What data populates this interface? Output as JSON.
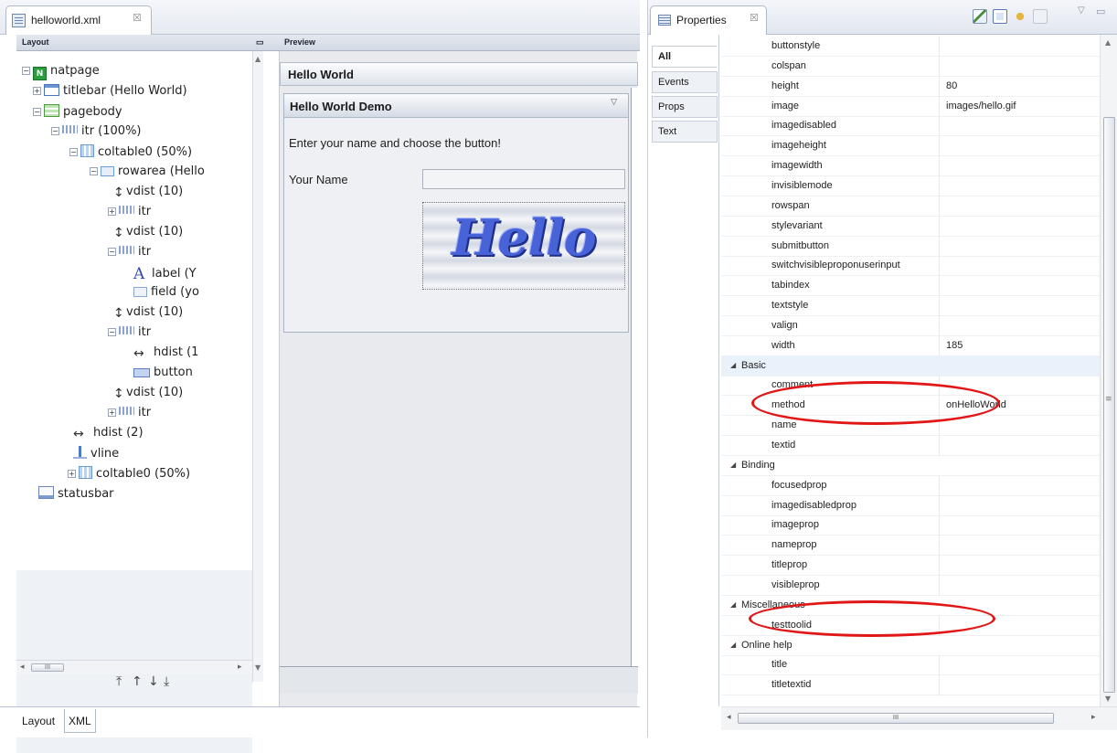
{
  "editor": {
    "tab_title": "helloworld.xml",
    "close_glyph": "☒",
    "layout_header": "Layout",
    "preview_header": "Preview",
    "tree": [
      {
        "label": "natpage",
        "icon": "natpage-icon",
        "toggle": "−"
      },
      {
        "label": "titlebar (Hello World)",
        "icon": "titlebar-icon",
        "toggle": "+"
      },
      {
        "label": "pagebody",
        "icon": "pagebody-icon",
        "toggle": "−"
      },
      {
        "label": "itr (100%)",
        "icon": "itr-icon",
        "toggle": "−"
      },
      {
        "label": "coltable0 (50%)",
        "icon": "coltable-icon",
        "toggle": "−"
      },
      {
        "label": "rowarea (Hello",
        "icon": "rowarea-icon",
        "toggle": "−"
      },
      {
        "label": "vdist (10)",
        "icon": "vdist-icon",
        "toggle": ""
      },
      {
        "label": "itr",
        "icon": "itr-icon",
        "toggle": "+"
      },
      {
        "label": "vdist (10)",
        "icon": "vdist-icon",
        "toggle": ""
      },
      {
        "label": "itr",
        "icon": "itr-icon",
        "toggle": "−"
      },
      {
        "label": "label (Y",
        "icon": "label-icon",
        "toggle": ""
      },
      {
        "label": "field (yo",
        "icon": "field-icon",
        "toggle": ""
      },
      {
        "label": "vdist (10)",
        "icon": "vdist-icon",
        "toggle": ""
      },
      {
        "label": "itr",
        "icon": "itr-icon",
        "toggle": "−"
      },
      {
        "label": "hdist (1",
        "icon": "hdist-icon",
        "toggle": ""
      },
      {
        "label": "button",
        "icon": "button-icon",
        "toggle": ""
      },
      {
        "label": "vdist (10)",
        "icon": "vdist-icon",
        "toggle": ""
      },
      {
        "label": "itr",
        "icon": "itr-icon",
        "toggle": "+"
      },
      {
        "label": "hdist (2)",
        "icon": "hdist-icon",
        "toggle": ""
      },
      {
        "label": "vline",
        "icon": "vline-icon",
        "toggle": ""
      },
      {
        "label": "coltable0 (50%)",
        "icon": "coltable-icon",
        "toggle": "+"
      },
      {
        "label": "statusbar",
        "icon": "statusbar-icon",
        "toggle": ""
      }
    ],
    "move_buttons": [
      "⤒",
      "↑",
      "↓",
      "⤓"
    ],
    "bottom_tabs": [
      "Layout",
      "XML"
    ],
    "preview": {
      "page_title": "Hello World",
      "box_title": "Hello World Demo",
      "instruction": "Enter your name and choose the button!",
      "name_label": "Your Name",
      "name_value": "",
      "button_image_text": "Hello"
    }
  },
  "properties": {
    "tab_title": "Properties",
    "close_glyph": "☒",
    "categories": [
      "All",
      "Events",
      "Props",
      "Text"
    ],
    "rows": [
      {
        "name": "buttonstyle",
        "value": ""
      },
      {
        "name": "colspan",
        "value": ""
      },
      {
        "name": "height",
        "value": "80"
      },
      {
        "name": "image",
        "value": "images/hello.gif"
      },
      {
        "name": "imagedisabled",
        "value": ""
      },
      {
        "name": "imageheight",
        "value": ""
      },
      {
        "name": "imagewidth",
        "value": ""
      },
      {
        "name": "invisiblemode",
        "value": ""
      },
      {
        "name": "rowspan",
        "value": ""
      },
      {
        "name": "stylevariant",
        "value": ""
      },
      {
        "name": "submitbutton",
        "value": ""
      },
      {
        "name": "switchvisibleproponuserinput",
        "value": ""
      },
      {
        "name": "tabindex",
        "value": ""
      },
      {
        "name": "textstyle",
        "value": ""
      },
      {
        "name": "valign",
        "value": ""
      },
      {
        "name": "width",
        "value": "185"
      },
      {
        "category": "Basic"
      },
      {
        "name": "comment",
        "value": ""
      },
      {
        "name": "method",
        "value": "onHelloWorld"
      },
      {
        "name": "name",
        "value": ""
      },
      {
        "name": "textid",
        "value": ""
      },
      {
        "category": "Binding"
      },
      {
        "name": "focusedprop",
        "value": ""
      },
      {
        "name": "imagedisabledprop",
        "value": ""
      },
      {
        "name": "imageprop",
        "value": ""
      },
      {
        "name": "nameprop",
        "value": ""
      },
      {
        "name": "titleprop",
        "value": ""
      },
      {
        "name": "visibleprop",
        "value": ""
      },
      {
        "category": "Miscellaneous"
      },
      {
        "name": "testtoolid",
        "value": ""
      },
      {
        "category": "Online help"
      },
      {
        "name": "title",
        "value": ""
      },
      {
        "name": "titletextid",
        "value": ""
      }
    ],
    "highlight_color": "#e11717"
  }
}
